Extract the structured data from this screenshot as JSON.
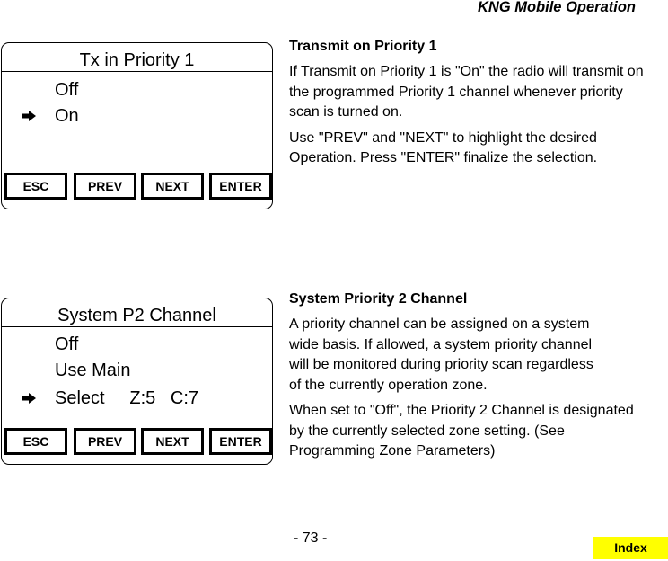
{
  "header": {
    "title": "KNG Mobile Operation"
  },
  "screens": [
    {
      "title": "Tx in Priority 1",
      "options": [
        {
          "label": "Off",
          "selected": false
        },
        {
          "label": "On",
          "selected": true
        }
      ],
      "softkeys": [
        "ESC",
        "PREV",
        "NEXT",
        "ENTER"
      ]
    },
    {
      "title": "System P2 Channel",
      "options": [
        {
          "label": "Off",
          "selected": false
        },
        {
          "label": "Use Main",
          "selected": false
        },
        {
          "label": "Select     Z:5   C:7",
          "selected": true
        }
      ],
      "softkeys": [
        "ESC",
        "PREV",
        "NEXT",
        "ENTER"
      ]
    }
  ],
  "sections": [
    {
      "heading": "Transmit on Priority 1",
      "paragraphs": [
        "If Transmit on Priority 1 is \"On\" the radio will transmit on the programmed Priority 1 channel whenever priority scan is turned on.",
        "Use \"PREV\" and \"NEXT\" to highlight the desired Operation. Press \"ENTER\" finalize the selection."
      ]
    },
    {
      "heading": "System Priority 2 Channel",
      "paragraphs": [
        "A priority channel can be assigned  on a system wide basis. If allowed, a system priority channel will be monitored during priority scan regardless of the currently operation zone.",
        "When set to \"Off\", the Priority 2 Channel is designated by the currently selected zone setting. (See Programming Zone Parameters)"
      ]
    }
  ],
  "footer": {
    "page_number": "- 73 -",
    "index_label": "Index",
    "index_color": "#ffff00"
  },
  "icons": {
    "selection_marker": "right-arrow-icon"
  }
}
